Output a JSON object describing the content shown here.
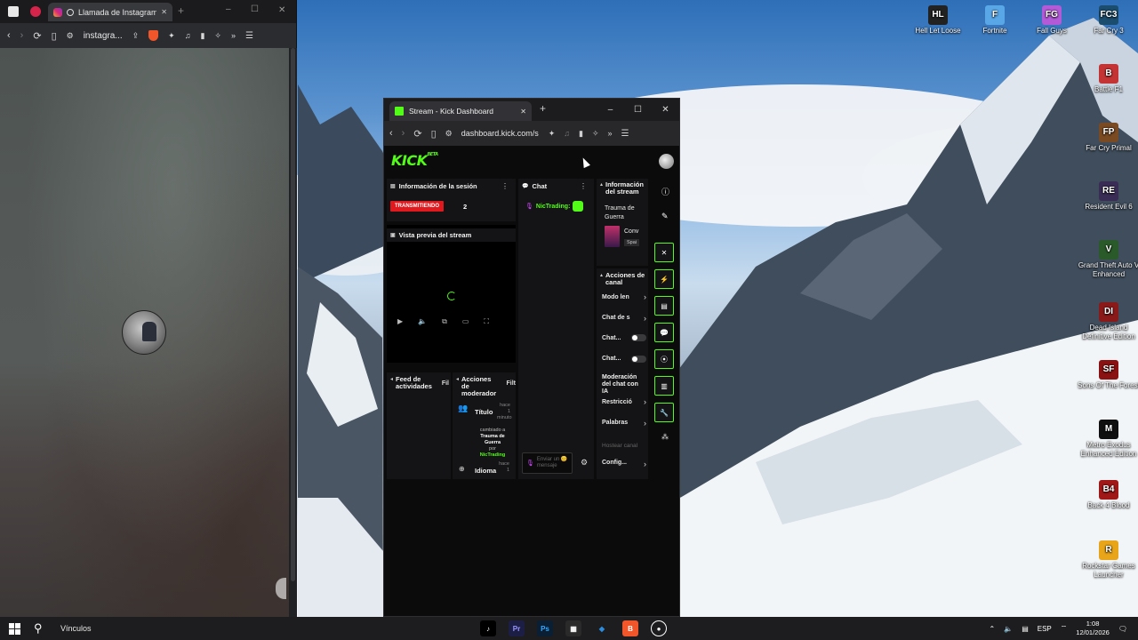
{
  "desktop": {
    "icons": [
      {
        "label": "Hell Let Loose",
        "glyph": "HL",
        "color": "#222222"
      },
      {
        "label": "Fortnite",
        "glyph": "F",
        "color": "#5aa7e8"
      },
      {
        "label": "Fall Guys",
        "glyph": "FG",
        "color": "#b25ad8"
      },
      {
        "label": "Far Cry 3",
        "glyph": "FC3",
        "color": "#1b4d6e"
      },
      {
        "label": "Battle F1",
        "glyph": "B",
        "color": "#c43434"
      },
      {
        "label": "Far Cry Primal",
        "glyph": "FP",
        "color": "#7a4a22"
      },
      {
        "label": "Resident Evil 6",
        "glyph": "RE",
        "color": "#3a2d55"
      },
      {
        "label": "Grand Theft Auto V Enhanced",
        "glyph": "V",
        "color": "#2a5a2a"
      },
      {
        "label": "Dead Island Definitive Edition",
        "glyph": "DI",
        "color": "#8a1a1a"
      },
      {
        "label": "Sons Of The Forest",
        "glyph": "SF",
        "color": "#8a1212"
      },
      {
        "label": "Metro Exodus Enhanced Edition",
        "glyph": "M",
        "color": "#101010"
      },
      {
        "label": "Back 4 Blood",
        "glyph": "B4",
        "color": "#a01818"
      },
      {
        "label": "Rockstar Games Launcher",
        "glyph": "R",
        "color": "#e8a51a"
      }
    ]
  },
  "left_browser": {
    "tab_title": "Llamada de Instagram",
    "url": "instagra...",
    "new_tab": "+",
    "win_min": "–",
    "win_max": "☐",
    "win_close": "✕"
  },
  "kick_browser": {
    "tab_title": "Stream - Kick Dashboard",
    "tab_close": "✕",
    "new_tab": "+",
    "url": "dashboard.kick.com/s",
    "win_min": "–",
    "win_max": "☐",
    "win_close": "✕",
    "logo": "KICK",
    "logo_super": "BETA",
    "session": {
      "title": "Información de la sesión",
      "live_badge": "TRANSMITIENDO",
      "viewers": "2",
      "preview_title": "Vista previa del stream"
    },
    "chat": {
      "title": "Chat",
      "message_user": "NicTrading:",
      "input_placeholder": "Enviar un 😊 mensaje"
    },
    "stream_info": {
      "title": "Información del stream",
      "stream_title": "Trauma de Guerra",
      "category_line1": "Conv",
      "category_line2": "Spai"
    },
    "channel_actions": {
      "title": "Acciones de canal",
      "items": [
        {
          "label": "Modo len",
          "type": "chevron"
        },
        {
          "label": "Chat de s",
          "type": "chevron"
        },
        {
          "label": "Chat...",
          "type": "toggle"
        },
        {
          "label": "Chat...",
          "type": "toggle"
        }
      ],
      "ai_moderation": "Moderación del chat con IA",
      "ai_more": "",
      "items2": [
        {
          "label": "Restricció",
          "type": "chevron"
        },
        {
          "label": "Palabras",
          "type": "chevron"
        }
      ],
      "host_label": "Hostear canal",
      "config_label": "Config..."
    },
    "activity_feed": {
      "title": "Feed de actividades",
      "filter": "Fil"
    },
    "mod_actions": {
      "title": "Acciones de moderador",
      "filter": "Filt",
      "entry1_title": "Título",
      "entry1_time": "hace 1 minuto",
      "entry1_text_a": "cambiado a",
      "entry1_text_b": "Trauma de Guerra",
      "entry1_text_c": "por",
      "entry1_user": "NicTrading",
      "entry2_title": "Idioma",
      "entry2_time": "hace 1"
    }
  },
  "taskbar": {
    "search_label": "Vínculos",
    "language": "ESP",
    "time": "1:08",
    "date": "12/01/2026"
  },
  "colors": {
    "kick_green": "#53fc18",
    "live_red": "#e0191f"
  }
}
